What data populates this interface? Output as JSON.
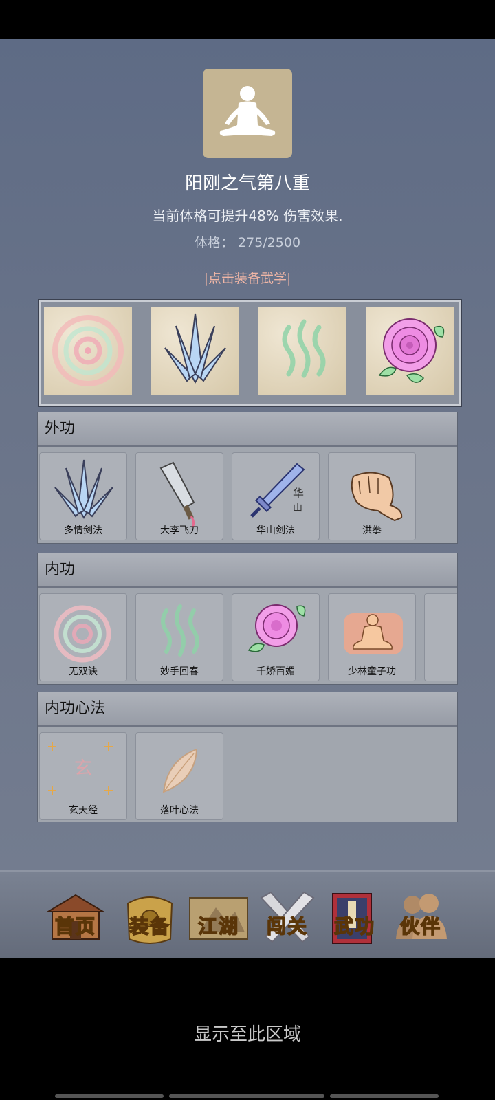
{
  "header": {
    "title": "阳刚之气第八重",
    "description": "当前体格可提升48% 伤害效果.",
    "stat_label": "体格：",
    "stat_value": "275/2500",
    "equip_link": "|点击装备武学|"
  },
  "equipped": [
    {
      "icon": "spiral-icon"
    },
    {
      "icon": "blades-icon"
    },
    {
      "icon": "wave-icon"
    },
    {
      "icon": "rose-icon"
    }
  ],
  "sections": [
    {
      "title": "外功",
      "skills": [
        "多情剑法",
        "大李飞刀",
        "华山剑法",
        "洪拳"
      ]
    },
    {
      "title": "内功",
      "skills": [
        "无双诀",
        "妙手回春",
        "千娇百媚",
        "少林童子功"
      ]
    },
    {
      "title": "内功心法",
      "skills": [
        "玄天经",
        "落叶心法"
      ]
    }
  ],
  "nav": [
    "首页",
    "装备",
    "江湖",
    "闯关",
    "武功",
    "伙伴"
  ],
  "footer": {
    "area_text": "显示至此区域"
  }
}
